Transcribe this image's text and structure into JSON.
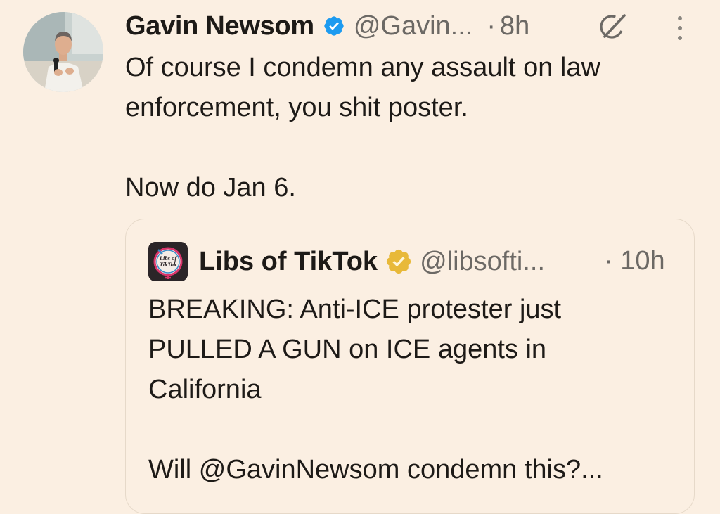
{
  "tweet": {
    "author_name": "Gavin Newsom",
    "author_handle": "@Gavin...",
    "dot": "·",
    "time": "8h",
    "verified_badge_icon": "blue-verified-check-icon",
    "grok_icon": "grok-icon",
    "more_icon": "more-vertical-icon",
    "text_lines": [
      "Of course I condemn any assault on law",
      "enforcement, you shit poster.",
      "",
      "Now do Jan 6."
    ]
  },
  "quoted_tweet": {
    "author_name": "Libs of TikTok",
    "author_handle": "@libsofti...",
    "time": "· 10h",
    "verified_badge_icon": "gold-verified-check-icon",
    "avatar_logo_text": "Libs of TikTok",
    "text_lines": [
      "BREAKING: Anti-ICE protester just",
      "PULLED A GUN on ICE agents in",
      "California",
      "",
      "Will @GavinNewsom condemn this?..."
    ]
  },
  "colors": {
    "background": "#fbefe2",
    "text_primary": "#1d1a17",
    "text_secondary": "#6c6965",
    "blue_badge": "#1d9bf0",
    "gold_badge": "#e8b939",
    "quote_border": "#e6d9c9"
  }
}
